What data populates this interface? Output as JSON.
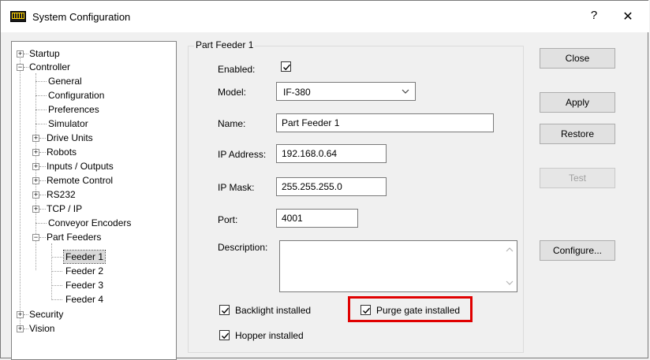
{
  "window": {
    "title": "System Configuration",
    "help_label": "?",
    "close_label": "✕"
  },
  "tree": {
    "items": [
      {
        "label": "Startup"
      },
      {
        "label": "Controller"
      },
      {
        "label": "General"
      },
      {
        "label": "Configuration"
      },
      {
        "label": "Preferences"
      },
      {
        "label": "Simulator"
      },
      {
        "label": "Drive Units"
      },
      {
        "label": "Robots"
      },
      {
        "label": "Inputs / Outputs"
      },
      {
        "label": "Remote Control"
      },
      {
        "label": "RS232"
      },
      {
        "label": "TCP / IP"
      },
      {
        "label": "Conveyor Encoders"
      },
      {
        "label": "Part Feeders"
      },
      {
        "label": "Feeder 1"
      },
      {
        "label": "Feeder 2"
      },
      {
        "label": "Feeder 3"
      },
      {
        "label": "Feeder 4"
      },
      {
        "label": "Security"
      },
      {
        "label": "Vision"
      }
    ]
  },
  "panel": {
    "group_title": "Part Feeder 1",
    "enabled_label": "Enabled:",
    "enabled_checked": true,
    "model_label": "Model:",
    "model_value": "IF-380",
    "name_label": "Name:",
    "name_value": "Part Feeder 1",
    "ip_address_label": "IP Address:",
    "ip_address_value": "192.168.0.64",
    "ip_mask_label": "IP Mask:",
    "ip_mask_value": "255.255.255.0",
    "port_label": "Port:",
    "port_value": "4001",
    "description_label": "Description:",
    "description_value": "",
    "backlight_label": "Backlight installed",
    "backlight_checked": true,
    "purge_gate_label": "Purge gate installed",
    "purge_gate_checked": true,
    "hopper_label": "Hopper installed",
    "hopper_checked": true
  },
  "buttons": {
    "close": "Close",
    "apply": "Apply",
    "restore": "Restore",
    "test": "Test",
    "configure": "Configure..."
  },
  "colors": {
    "highlight": "#e00000",
    "selection": "#d9d9d9"
  }
}
